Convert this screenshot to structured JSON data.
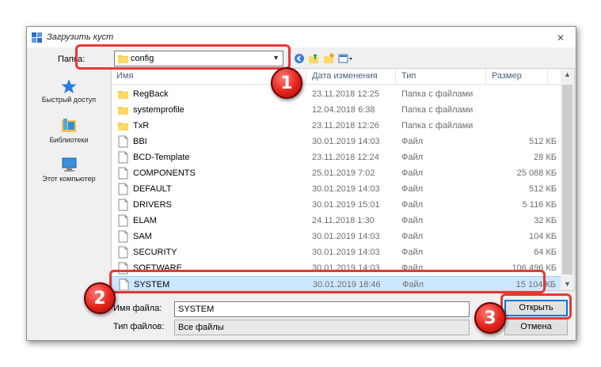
{
  "window": {
    "title": "Загрузить куст",
    "close_icon": "close-icon"
  },
  "toolbar": {
    "folder_label": "Папка:",
    "folder_value": "config"
  },
  "sidebar": {
    "items": [
      {
        "label": "Быстрый доступ",
        "icon": "star-icon"
      },
      {
        "label": "Библиотеки",
        "icon": "library-icon"
      },
      {
        "label": "Этот компьютер",
        "icon": "computer-icon"
      }
    ]
  },
  "columns": {
    "name": "Имя",
    "date": "Дата изменения",
    "type": "Тип",
    "size": "Размер"
  },
  "files": [
    {
      "name": "RegBack",
      "date": "23.11.2018 12:25",
      "type": "Папка с файлами",
      "size": "",
      "kind": "folder"
    },
    {
      "name": "systemprofile",
      "date": "12.04.2018 6:38",
      "type": "Папка с файлами",
      "size": "",
      "kind": "folder"
    },
    {
      "name": "TxR",
      "date": "23.11.2018 12:26",
      "type": "Папка с файлами",
      "size": "",
      "kind": "folder"
    },
    {
      "name": "BBI",
      "date": "30.01.2019 14:03",
      "type": "Файл",
      "size": "512 КБ",
      "kind": "file"
    },
    {
      "name": "BCD-Template",
      "date": "23.11.2018 12:24",
      "type": "Файл",
      "size": "28 КБ",
      "kind": "file"
    },
    {
      "name": "COMPONENTS",
      "date": "25.01.2019 7:02",
      "type": "Файл",
      "size": "25 088 КБ",
      "kind": "file"
    },
    {
      "name": "DEFAULT",
      "date": "30.01.2019 14:03",
      "type": "Файл",
      "size": "512 КБ",
      "kind": "file"
    },
    {
      "name": "DRIVERS",
      "date": "30.01.2019 15:01",
      "type": "Файл",
      "size": "5 116 КБ",
      "kind": "file"
    },
    {
      "name": "ELAM",
      "date": "24.11.2018 1:30",
      "type": "Файл",
      "size": "32 КБ",
      "kind": "file"
    },
    {
      "name": "SAM",
      "date": "30.01.2019 14:03",
      "type": "Файл",
      "size": "104 КБ",
      "kind": "file"
    },
    {
      "name": "SECURITY",
      "date": "30.01.2019 14:03",
      "type": "Файл",
      "size": "64 КБ",
      "kind": "file"
    },
    {
      "name": "SOFTWARE",
      "date": "30.01.2019 14:03",
      "type": "Файл",
      "size": "106 496 КБ",
      "kind": "file"
    },
    {
      "name": "SYSTEM",
      "date": "30.01.2019 18:46",
      "type": "Файл",
      "size": "15 104 КБ",
      "kind": "file",
      "selected": true
    }
  ],
  "bottom": {
    "filename_label": "Имя файла:",
    "filename_value": "SYSTEM",
    "filetype_label": "Тип файлов:",
    "filetype_value": "Все файлы",
    "open_button": "Открыть",
    "cancel_button": "Отмена"
  },
  "annotations": {
    "step1": "1",
    "step2": "2",
    "step3": "3",
    "color": "#e53935"
  }
}
